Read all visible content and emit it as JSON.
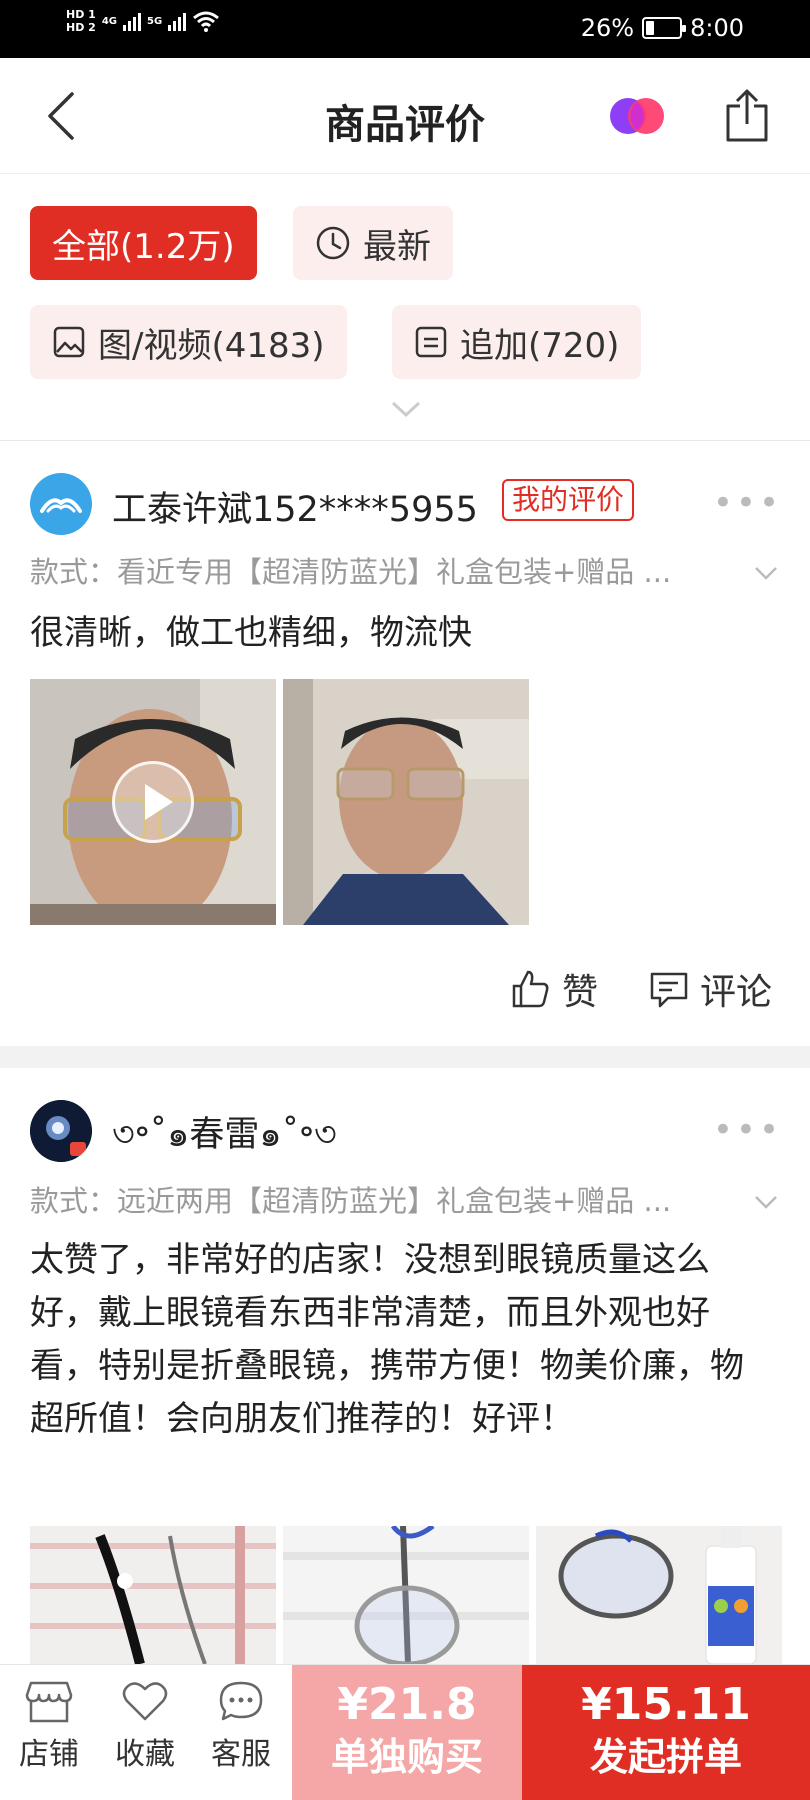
{
  "status_bar": {
    "hd1": "HD 1",
    "hd2": "HD 2",
    "net1": "4G",
    "net2": "5G",
    "battery": "26%",
    "battery_level": 0.26,
    "time": "8:00"
  },
  "nav": {
    "title": "商品评价",
    "back_icon": "chevron-left-icon",
    "share_icon": "share-icon"
  },
  "filters": {
    "all": "全部(1.2万)",
    "latest": "最新",
    "media": "图/视频(4183)",
    "append": "追加(720)"
  },
  "reviews": [
    {
      "username": "工泰许斌152****5955",
      "tag": "我的评价",
      "more": "•••",
      "spec": "款式：看近专用【超清防蓝光】礼盒包装+赠品 ...",
      "text": "很清晰，做工也精细，物流快",
      "like_label": "赞",
      "comment_label": "评论"
    },
    {
      "username": "৩॰˚๑春雷๑˚॰৩",
      "more": "•••",
      "spec": "款式：远近两用【超清防蓝光】礼盒包装+赠品 ...",
      "text": "太赞了，非常好的店家！没想到眼镜质量这么好，戴上眼镜看东西非常清楚，而且外观也好看，特别是折叠眼镜，携带方便！物美价廉，物超所值！会向朋友们推荐的！好评！"
    }
  ],
  "bottom_bar": {
    "store": "店铺",
    "favorite": "收藏",
    "service": "客服",
    "single_price": "¥21.8",
    "single_label": "单独购买",
    "group_price": "¥15.11",
    "group_label": "发起拼单"
  },
  "colors": {
    "accent": "#e02e24",
    "chip_bg": "#fdeeee",
    "single_buy": "#f5a6a6"
  }
}
